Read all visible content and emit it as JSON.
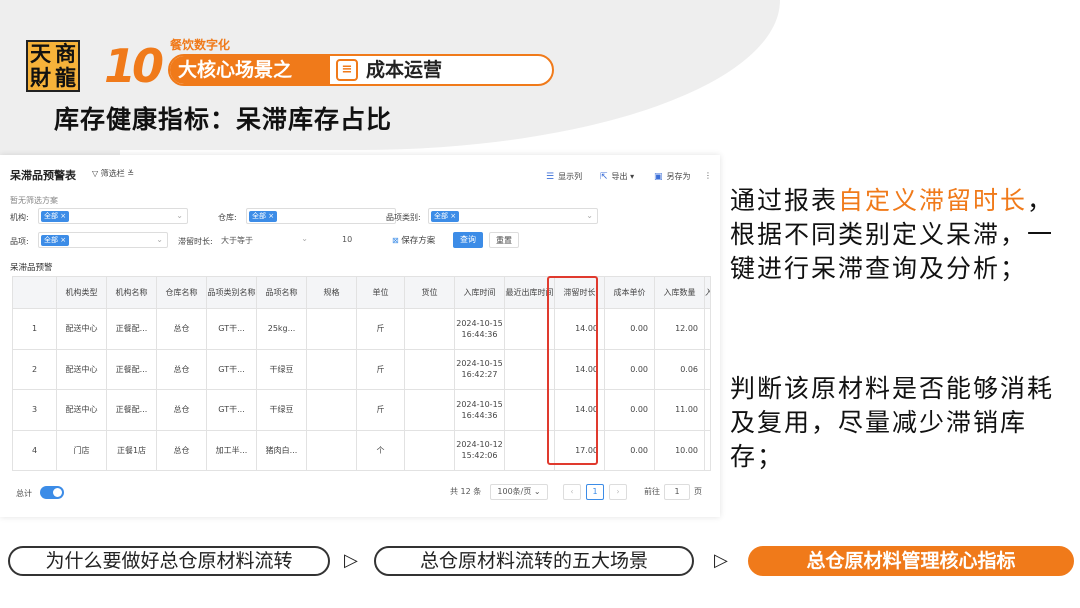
{
  "logo": {
    "chars": [
      "天",
      "商",
      "財",
      "龍"
    ]
  },
  "header": {
    "number": "10",
    "banner_sub": "餐饮数字化",
    "banner_left": "大核心场景之",
    "banner_right": "成本运营"
  },
  "subtitle": "库存健康指标：呆滞库存占比",
  "panel": {
    "title": "呆滞品预警表",
    "filter_toggle": "筛选栏",
    "tools": {
      "columns": "显示列",
      "export": "导出",
      "save_as": "另存为",
      "more": "⋮"
    },
    "no_scheme": "暂无筛选方案",
    "filters": {
      "org_label": "机构:",
      "org_tag": "全部",
      "warehouse_label": "仓库:",
      "warehouse_tag": "全部",
      "category_label": "品项类别:",
      "category_tag": "全部",
      "item_label": "品项:",
      "item_tag": "全部",
      "duration_label": "滞留时长:",
      "duration_op": "大于等于",
      "duration_value": "10"
    },
    "save_scheme": "保存方案",
    "query": "查询",
    "reset": "重置",
    "section_title": "呆滞品预警",
    "table": {
      "headers": [
        "",
        "机构类型",
        "机构名称",
        "仓库名称",
        "品项类别名称",
        "品项名称",
        "规格",
        "单位",
        "货位",
        "入库时间",
        "最近出库时间",
        "滞留时长",
        "成本单价",
        "入库数量",
        "入"
      ],
      "rows": [
        [
          "1",
          "配送中心",
          "正餐配...",
          "总仓",
          "GT干...",
          "25kg...",
          "",
          "斤",
          "",
          "2024-10-15 16:44:36",
          "",
          "14.00",
          "0.00",
          "12.00",
          ""
        ],
        [
          "2",
          "配送中心",
          "正餐配...",
          "总仓",
          "GT干...",
          "干绿豆",
          "",
          "斤",
          "",
          "2024-10-15 16:42:27",
          "",
          "14.00",
          "0.00",
          "0.06",
          ""
        ],
        [
          "3",
          "配送中心",
          "正餐配...",
          "总仓",
          "GT干...",
          "干绿豆",
          "",
          "斤",
          "",
          "2024-10-15 16:44:36",
          "",
          "14.00",
          "0.00",
          "11.00",
          ""
        ],
        [
          "4",
          "门店",
          "正餐1店",
          "总仓",
          "加工半...",
          "猪肉白...",
          "",
          "个",
          "",
          "2024-10-12 15:42:06",
          "",
          "17.00",
          "0.00",
          "10.00",
          ""
        ]
      ]
    },
    "footer": {
      "total_label": "总计",
      "total_count": "共 12 条",
      "page_size": "100条/页",
      "prev": "‹",
      "current_page": "1",
      "next": "›",
      "goto_label": "前往",
      "goto_value": "1",
      "page_unit": "页"
    }
  },
  "right_text": {
    "p1_a": "通过报表",
    "p1_hl": "自定义滞留时长",
    "p1_b": "，根据不同类别定义呆滞，一键进行呆滞查询及分析；",
    "p2": "判断该原材料是否能够消耗及复用，尽量减少滞销库存；"
  },
  "nav": {
    "items": [
      "为什么要做好总仓原材料流转",
      "总仓原材料流转的五大场景",
      "总仓原材料管理核心指标"
    ],
    "arrow": "▷"
  },
  "colors": {
    "accent": "#f07a1a",
    "primary": "#3c8ce7",
    "highlight": "#e03a2e"
  }
}
